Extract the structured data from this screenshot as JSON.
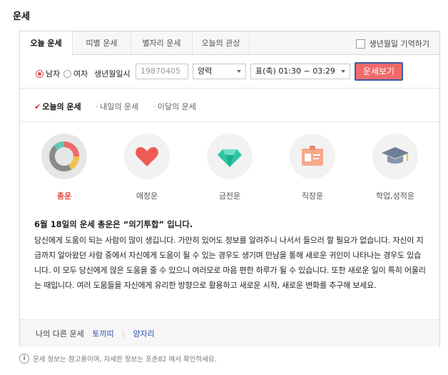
{
  "section_title": "운세",
  "tabs": [
    {
      "label": "오늘 운세",
      "active": true
    },
    {
      "label": "띠별 운세",
      "active": false
    },
    {
      "label": "별자리 운세",
      "active": false
    },
    {
      "label": "오늘의 관상",
      "active": false
    }
  ],
  "remember_label": "생년월일 기억하기",
  "form": {
    "gender_male": "남자",
    "gender_female": "여자",
    "birth_label": "생년월일시",
    "birth_placeholder": "19870405",
    "calendar_value": "양력",
    "time_value": "표(축) 01:30 ~ 03:29",
    "submit_label": "운세보기"
  },
  "subtabs": [
    {
      "label": "오늘의 운세",
      "active": true
    },
    {
      "label": "내일의 운세",
      "active": false
    },
    {
      "label": "이달의 운세",
      "active": false
    }
  ],
  "categories": [
    {
      "label": "총운",
      "icon": "donut-chart-icon",
      "active": true
    },
    {
      "label": "애정운",
      "icon": "heart-icon",
      "active": false
    },
    {
      "label": "금전운",
      "icon": "diamond-icon",
      "active": false
    },
    {
      "label": "직장운",
      "icon": "id-card-icon",
      "active": false
    },
    {
      "label": "학업,성적운",
      "icon": "graduation-cap-icon",
      "active": false
    }
  ],
  "fortune": {
    "headline": "6월 18일의 운세 총운은 “의기투합” 입니다.",
    "body": "당신에게 도움이 되는 사람이 많이 생깁니다. 가만히 있어도 정보를 알려주니 나서서 들으러 할 필요가 없습니다. 자신이 지금까지 알아왔던 사람 중에서 자신에게 도움이 될 수 있는 경우도 생기며 만남을 통해 새로운 귀인이 나타나는 경우도 있습니다. 이 모두 당신에게 많은 도움을 줄 수 있으니 여러모로 마음 편한 하루가 될 수 있습니다. 또한 새로운 일이 특히 어울리는 때입니다. 여러 도움들을 자신에게 유리한 방향으로 활용하고 새로운 시작, 새로운 변화를 추구해 보세요."
  },
  "other": {
    "label": "나의 다른 운세",
    "links": [
      "토끼띠",
      "양자리"
    ]
  },
  "note": "운세 정보는 참고용이며, 자세한 정보는 포춘82 에서 확인하세요.",
  "colors": {
    "accent": "#f16a6a",
    "active_label": "#e4473c",
    "link": "#2a4bb3"
  }
}
